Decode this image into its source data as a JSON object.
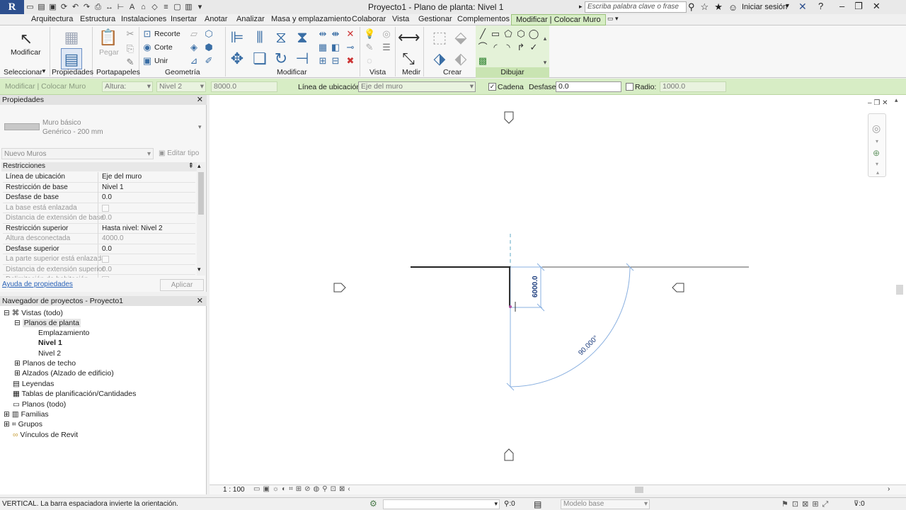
{
  "app": {
    "logo": "R",
    "title": "Proyecto1 - Plano de planta: Nivel 1",
    "search_placeholder": "Escriba palabra clave o frase",
    "signin": "Iniciar sesión"
  },
  "tabs": [
    "Arquitectura",
    "Estructura",
    "Instalaciones",
    "Insertar",
    "Anotar",
    "Analizar",
    "Masa y emplazamiento",
    "Colaborar",
    "Vista",
    "Gestionar",
    "Complementos",
    "Modificar | Colocar Muro"
  ],
  "ribbon": {
    "modificar_label": "Modificar",
    "pegar_label": "Pegar",
    "recorte": "Recorte",
    "corte": "Corte",
    "unir": "Unir",
    "panels": [
      "Seleccionar",
      "Propiedades",
      "Portapapeles",
      "Geometría",
      "Modificar",
      "Vista",
      "Medir",
      "Crear",
      "Dibujar"
    ]
  },
  "options": {
    "context": "Modificar | Colocar Muro",
    "altura": "Altura:",
    "nivel": "Nivel 2",
    "altura_val": "8000.0",
    "linea_label": "Línea de ubicación:",
    "linea_val": "Eje del muro",
    "cadena": "Cadena",
    "desfase_label": "Desfase:",
    "desfase_val": "0.0",
    "radio": "Radio:",
    "radio_val": "1000.0"
  },
  "properties": {
    "title": "Propiedades",
    "type_name": "Muro básico",
    "type_sub": "Genérico - 200 mm",
    "selector": "Nuevo Muros",
    "edit_type": "Editar tipo",
    "section": "Restricciones",
    "rows": [
      {
        "k": "Línea de ubicación",
        "v": "Eje del muro"
      },
      {
        "k": "Restricción de base",
        "v": "Nivel 1"
      },
      {
        "k": "Desfase de base",
        "v": "0.0"
      },
      {
        "k": "La base está enlazada",
        "v": ""
      },
      {
        "k": "Distancia de extensión de base",
        "v": "0.0"
      },
      {
        "k": "Restricción superior",
        "v": "Hasta nivel: Nivel 2"
      },
      {
        "k": "Altura desconectada",
        "v": "4000.0"
      },
      {
        "k": "Desfase superior",
        "v": "0.0"
      },
      {
        "k": "La parte superior está enlazada",
        "v": ""
      },
      {
        "k": "Distancia de extensión superior",
        "v": "0.0"
      },
      {
        "k": "Delimitación de habitación",
        "v": ""
      }
    ],
    "help": "Ayuda de propiedades",
    "apply": "Aplicar"
  },
  "browser": {
    "title": "Navegador de proyectos - Proyecto1",
    "nodes": [
      "Vistas (todo)",
      "Planos de planta",
      "Emplazamiento",
      "Nivel 1",
      "Nivel 2",
      "Planos de techo",
      "Alzados (Alzado de edificio)",
      "Leyendas",
      "Tablas de planificación/Cantidades",
      "Planos (todo)",
      "Familias",
      "Grupos",
      "Vínculos de Revit"
    ]
  },
  "canvas": {
    "dim": "6000.0",
    "angle": "90.000°"
  },
  "view_control": {
    "scale": "1 : 100"
  },
  "status": {
    "text": "VERTICAL. La barra espaciadora invierte la orientación.",
    "zero": ":0",
    "model": "Modelo base",
    "filter": ":0"
  }
}
